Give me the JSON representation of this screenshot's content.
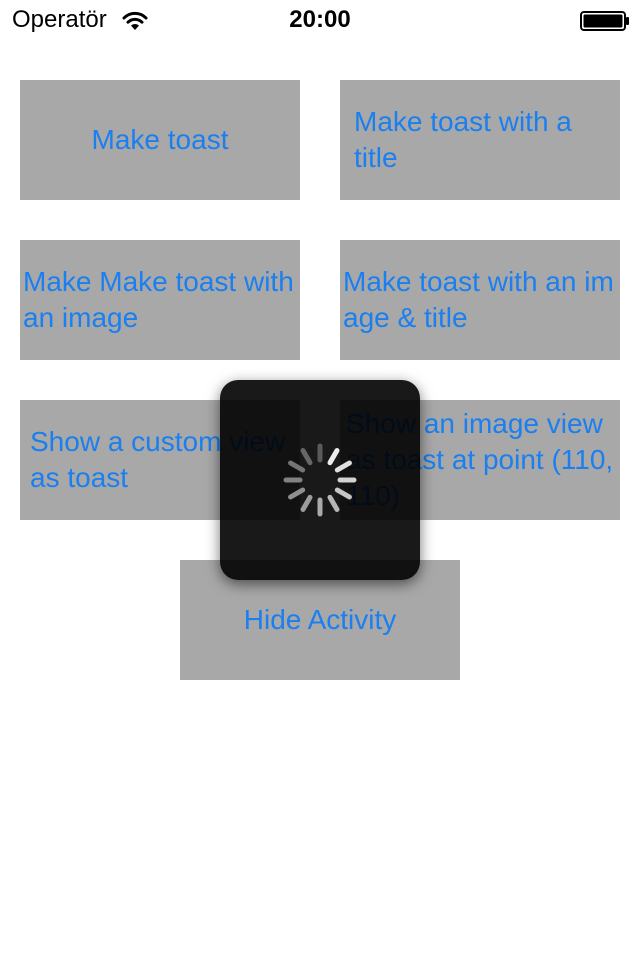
{
  "status_bar": {
    "carrier": "Operatör",
    "time": "20:00",
    "wifi_icon": "wifi-icon",
    "battery_icon": "battery-full-icon"
  },
  "buttons": {
    "make_toast": "Make toast",
    "toast_with_title": "Make toast with a title",
    "toast_with_image": "Make Make toast with an image",
    "toast_with_image_title": "Make toast with an image & title",
    "custom_view": "Show a custom view as toast",
    "image_view_point": "Show an image view as toast at point (110,110)",
    "hide_activity": "Hide Activity"
  },
  "activity_indicator": {
    "icon": "activity-spinner-icon"
  },
  "colors": {
    "button_background": "#a8a8a8",
    "button_text": "#1a7ff0",
    "overlay": "#111111"
  }
}
